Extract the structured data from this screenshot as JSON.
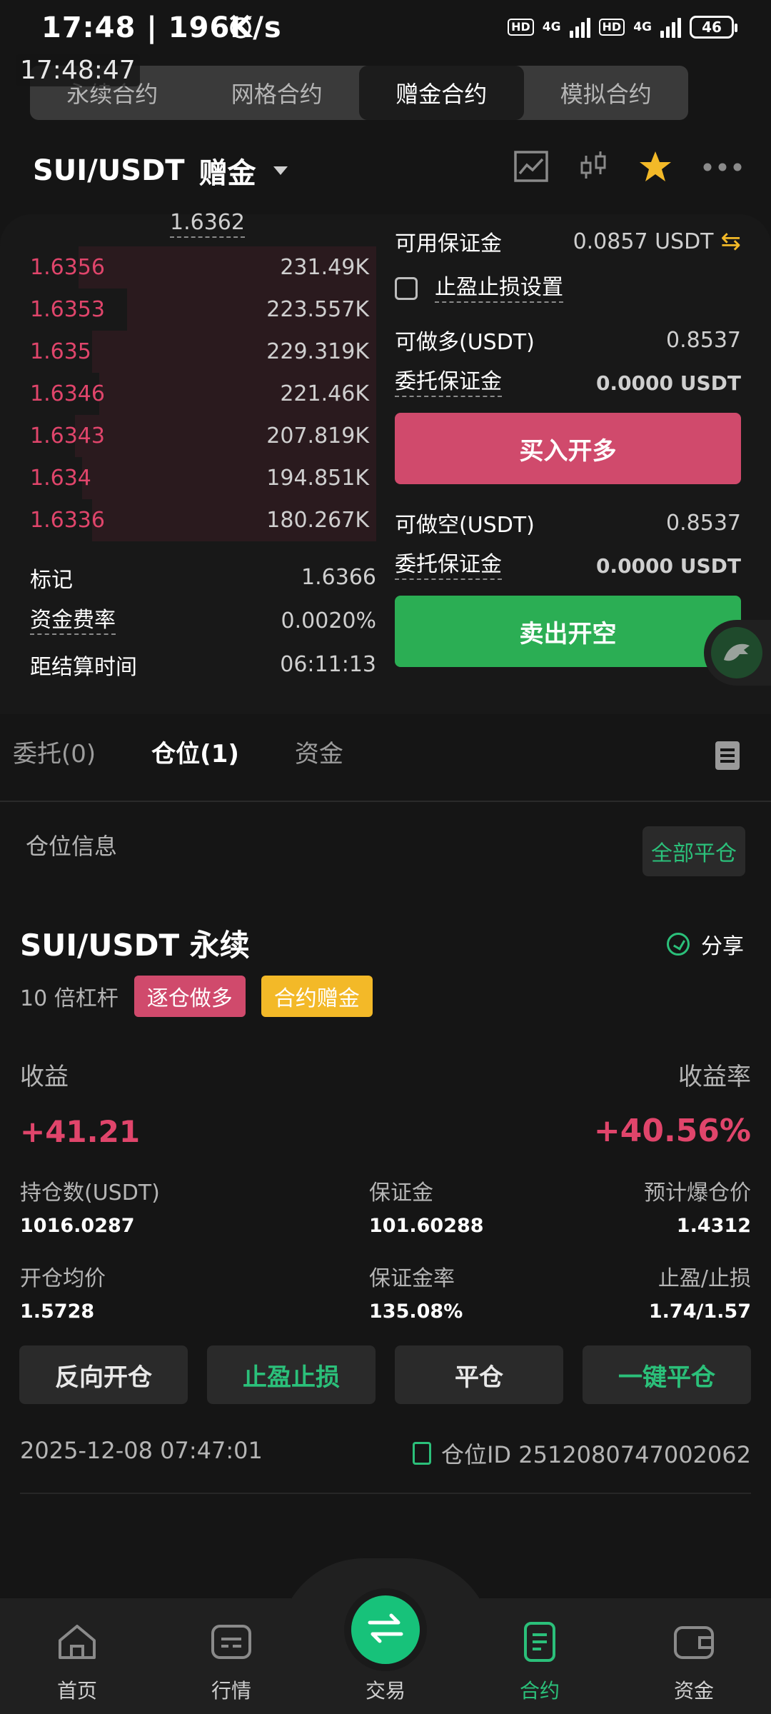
{
  "status_bar": {
    "time": "17:48 | 196K/s",
    "hd1": "HD",
    "net1": "4G",
    "hd2": "HD",
    "net2": "4G",
    "battery": "46",
    "clock_overlay": "17:48:47"
  },
  "contract_tabs": [
    "永续合约",
    "网格合约",
    "赠金合约",
    "模拟合约"
  ],
  "header": {
    "pair": "SUI/USDT",
    "mode": "赠金",
    "icons": [
      "line-chart-icon",
      "candlestick-icon",
      "star-icon",
      "more-icon"
    ]
  },
  "orderbook": {
    "mid_price": "1.6362",
    "asks": [
      {
        "price": "1.6356",
        "qty": "231.49K",
        "depth": 0.86
      },
      {
        "price": "1.6353",
        "qty": "223.557K",
        "depth": 0.72
      },
      {
        "price": "1.635",
        "qty": "229.319K",
        "depth": 0.82
      },
      {
        "price": "1.6346",
        "qty": "221.46K",
        "depth": 0.8
      },
      {
        "price": "1.6343",
        "qty": "207.819K",
        "depth": 0.87
      },
      {
        "price": "1.634",
        "qty": "194.851K",
        "depth": 0.85
      },
      {
        "price": "1.6336",
        "qty": "180.267K",
        "depth": 0.82
      }
    ]
  },
  "stats": {
    "mark_label": "标记",
    "mark_value": "1.6366",
    "funding_label": "资金费率",
    "funding_value": "0.0020%",
    "settle_label": "距结算时间",
    "settle_value": "06:11:13"
  },
  "order_form": {
    "avail_margin_label": "可用保证金",
    "avail_margin_value": "0.0857 USDT",
    "tpsl_label": "止盈止损设置",
    "can_long_label": "可做多(USDT)",
    "can_long_value": "0.8537",
    "order_margin_label": "委托保证金",
    "order_margin_value": "0.0000 USDT",
    "buy_button": "买入开多",
    "can_short_label": "可做空(USDT)",
    "can_short_value": "0.8537",
    "order_margin_label2": "委托保证金",
    "order_margin_value2": "0.0000 USDT",
    "sell_button": "卖出开空"
  },
  "tabs": {
    "orders": "委托(0)",
    "positions": "仓位(1)",
    "funds": "资金"
  },
  "position": {
    "info_label": "仓位信息",
    "close_all": "全部平仓",
    "title": "SUI/USDT 永续",
    "share": "分享",
    "leverage": "10 倍杠杆",
    "badge_side": "逐仓做多",
    "badge_bonus": "合约赠金",
    "pnl_label": "收益",
    "pnl_rate_label": "收益率",
    "pnl": "+41.21",
    "pnl_rate": "+40.56%",
    "size_label": "持仓数(USDT)",
    "size_value": "1016.0287",
    "margin_label": "保证金",
    "margin_value": "101.60288",
    "liq_label": "预计爆仓价",
    "liq_value": "1.4312",
    "entry_label": "开仓均价",
    "entry_value": "1.5728",
    "margin_rate_label": "保证金率",
    "margin_rate_value": "135.08%",
    "tpsl_label": "止盈/止损",
    "tpsl_value": "1.74/1.57",
    "btn_reverse": "反向开仓",
    "btn_tpsl": "止盈止损",
    "btn_close": "平仓",
    "btn_quick_close": "一键平仓",
    "open_time": "2025-12-08 07:47:01",
    "position_id": "仓位ID 2512080747002062"
  },
  "bottom_nav": [
    "首页",
    "行情",
    "交易",
    "合约",
    "资金"
  ],
  "colors": {
    "ask_red": "#e0456b",
    "buy_red": "#d04a6c",
    "sell_green": "#2bae54",
    "accent_green": "#2bc07a",
    "star_yellow": "#f3b928"
  }
}
